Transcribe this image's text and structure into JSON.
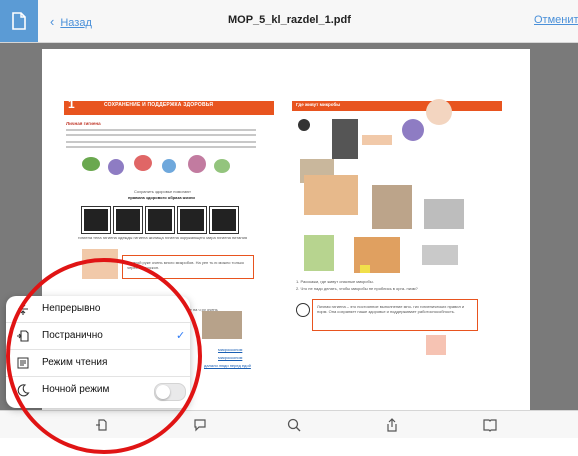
{
  "header": {
    "back_label": "Назад",
    "file_title": "MOP_5_kl_razdel_1.pdf",
    "cancel_label": "Отменить"
  },
  "page_content": {
    "part_number": "1",
    "part_label": "ЧАСТЬ",
    "left_heading": "СОХРАНЕНИЕ И ПОДДЕРЖКА ЗДОРОВЬЯ",
    "left_subheading": "Личная гигиена",
    "right_heading": "Где живут микробы",
    "pill_line1": "Сохранить здоровье помогают",
    "pill_line2": "правила здорового образа жизни",
    "card_labels": [
      "гигиена тела",
      "гигиена одежды",
      "гигиена жилища",
      "гигиена окружающего мира",
      "гигиена питания"
    ],
    "note_text": "Но этой руке очень много микробов. На уен ть ю можно только через микроскоп.",
    "q1": "1. Расскажи, где живут опасные микробы.",
    "q2": "2. Что не надо делать, чтобы микробы не проблись в орга- низм?",
    "definition": "Личная гигиена – это постоянное выполнение мно- гих гигиенических правил и норм. Она сохраняет наше здоровье и поддерживает работоспособность.",
    "link1": "микроскопом",
    "link2": "микроскопом",
    "link3": "далали люди перед едой",
    "hand_text": "Даже на ч  ру очень"
  },
  "view_menu": {
    "items": [
      {
        "label": "Непрерывно",
        "icon": "continuous-scroll-icon",
        "selected": false
      },
      {
        "label": "Постранично",
        "icon": "page-by-page-icon",
        "selected": true
      },
      {
        "label": "Режим чтения",
        "icon": "reading-mode-icon",
        "selected": false
      },
      {
        "label": "Ночной режим",
        "icon": "moon-icon",
        "selected": false,
        "toggle": true
      }
    ],
    "check_symbol": "✓"
  },
  "colors": {
    "accent": "#4a90d9",
    "annotation_red": "#e01414",
    "page_heading_orange": "#e8541f"
  }
}
